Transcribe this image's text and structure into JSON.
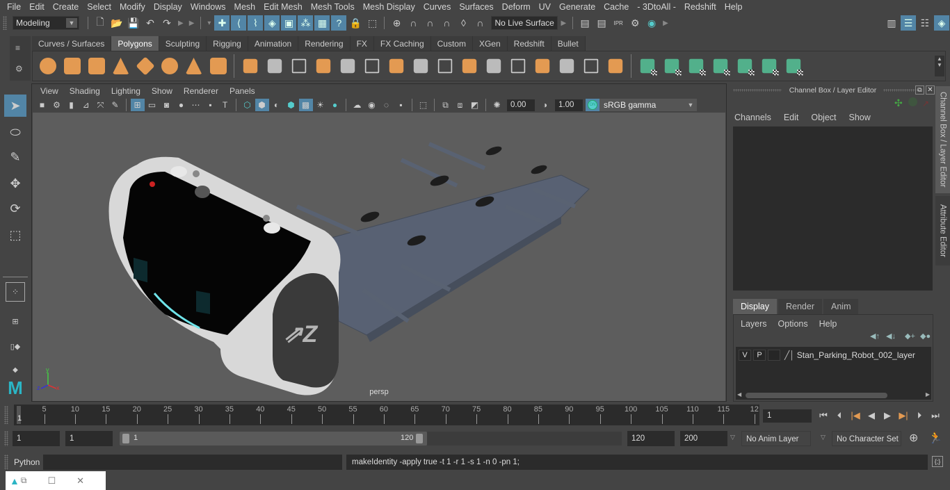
{
  "menubar": {
    "items": [
      "File",
      "Edit",
      "Create",
      "Select",
      "Modify",
      "Display",
      "Windows",
      "Mesh",
      "Edit Mesh",
      "Mesh Tools",
      "Mesh Display",
      "Curves",
      "Surfaces",
      "Deform",
      "UV",
      "Generate",
      "Cache",
      "- 3DtoAll -",
      "Redshift",
      "Help"
    ]
  },
  "statusline": {
    "workspace": "Modeling",
    "live_surface": "No Live Surface",
    "icons": [
      "new-scene",
      "open-scene",
      "save-scene",
      "undo",
      "redo",
      "select-hierarchy",
      "select-object",
      "select-component",
      "select-by-curve",
      "select-by-surface",
      "select-by-poly",
      "select-by-render",
      "select-help",
      "lock-selection",
      "highlight-selection",
      "snap-grid",
      "snap-curve",
      "snap-point",
      "snap-view-plane",
      "snap-live",
      "render-current",
      "render-sequence",
      "ipr-render",
      "render-settings",
      "hypershade"
    ]
  },
  "shelf": {
    "tabs": [
      "Curves / Surfaces",
      "Polygons",
      "Sculpting",
      "Rigging",
      "Animation",
      "Rendering",
      "FX",
      "FX Caching",
      "Custom",
      "XGen",
      "Redshift",
      "Bullet"
    ],
    "active_tab": "Polygons",
    "orange_icons": [
      "poly-sphere",
      "poly-cube",
      "poly-cylinder",
      "poly-cone",
      "poly-torus-diamond",
      "poly-torus",
      "poly-pyramid",
      "poly-pipe"
    ],
    "tool_icons": [
      "combine",
      "separate",
      "mirror",
      "smooth",
      "extract",
      "boolean",
      "bridge",
      "multi-cut",
      "extrude",
      "bevel",
      "fill-hole",
      "bridge-edge",
      "append",
      "merge",
      "insert-edge",
      "poly-offset"
    ],
    "uv_icons": [
      "planar-map",
      "cylindrical-map",
      "spherical-map",
      "automatic-map",
      "unfold",
      "uv-editor",
      "layout-uvs"
    ]
  },
  "toolbox": {
    "tools": [
      "select-tool",
      "lasso-tool",
      "paint-select-tool",
      "move-tool",
      "rotate-tool",
      "scale-tool"
    ],
    "layout_icons": [
      "single-perspective-layout",
      "four-view-layout",
      "outliner-persp-layout",
      "graph-persp-layout"
    ]
  },
  "viewport": {
    "menu": [
      "View",
      "Shading",
      "Lighting",
      "Show",
      "Renderer",
      "Panels"
    ],
    "exposure": "0.00",
    "gamma": "1.00",
    "color_management": "ON",
    "color_space": "sRGB gamma",
    "camera_label": "persp",
    "axis_labels": {
      "x": "x",
      "y": "y",
      "z": "z"
    }
  },
  "channel_box": {
    "title": "Channel Box / Layer Editor",
    "menu": [
      "Channels",
      "Edit",
      "Object",
      "Show"
    ]
  },
  "layer_editor": {
    "tabs": [
      "Display",
      "Render",
      "Anim"
    ],
    "active_tab": "Display",
    "menu": [
      "Layers",
      "Options",
      "Help"
    ],
    "layers": [
      {
        "visible": "V",
        "playback": "P",
        "name": "Stan_Parking_Robot_002_layer"
      }
    ]
  },
  "side_tabs": [
    "Channel Box / Layer Editor",
    "Attribute Editor"
  ],
  "timeline": {
    "tick_labels": [
      "5",
      "10",
      "15",
      "20",
      "25",
      "30",
      "35",
      "40",
      "45",
      "50",
      "55",
      "60",
      "65",
      "70",
      "75",
      "80",
      "85",
      "90",
      "95",
      "100",
      "105",
      "110",
      "115",
      "12"
    ],
    "start_marker": "1",
    "current_frame": "1",
    "range_start": "1",
    "range_inner_start": "1",
    "slider_start": "1",
    "slider_end": "120",
    "range_inner_end": "120",
    "range_end": "200",
    "anim_layer": "No Anim Layer",
    "character_set": "No Character Set"
  },
  "command_line": {
    "language": "Python",
    "input": "",
    "result": "makeIdentity -apply true -t 1 -r 1 -s 1 -n 0 -pn 1;"
  }
}
